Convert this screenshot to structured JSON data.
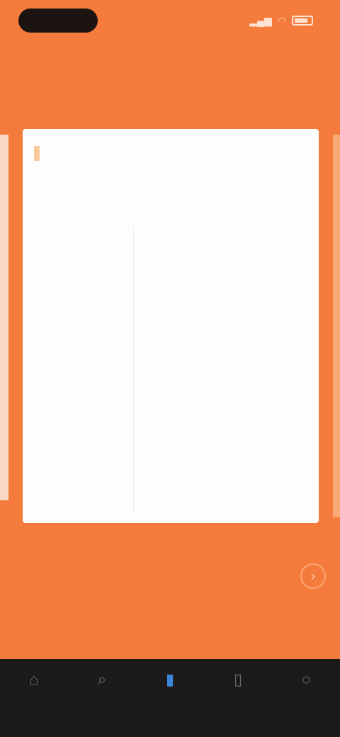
{
  "status": {
    "time": "",
    "icons": [
      "signal-icon",
      "wifi-icon",
      "battery-icon"
    ]
  },
  "header": {
    "title": ""
  },
  "card": {
    "heading_before": "",
    "heading_highlight": "",
    "heading_after": "",
    "rows": [
      {
        "term": "",
        "def": ""
      },
      {
        "term": "",
        "def": ""
      },
      {
        "term": "",
        "def": ""
      },
      {
        "term": "",
        "def": ""
      },
      {
        "term": "",
        "def": ""
      },
      {
        "term": "",
        "def": ""
      },
      {
        "term": "",
        "def": ""
      }
    ]
  },
  "page_indicator": "",
  "nav": {
    "items": [
      {
        "name": "home",
        "label": "",
        "icon": "home-icon"
      },
      {
        "name": "search",
        "label": "",
        "icon": "search-icon"
      },
      {
        "name": "learn",
        "label": "",
        "icon": "book-icon",
        "active": true
      },
      {
        "name": "saved",
        "label": "",
        "icon": "bookmark-icon"
      },
      {
        "name": "profile",
        "label": "",
        "icon": "profile-icon"
      }
    ]
  },
  "colors": {
    "background": "#f47b3c",
    "card": "#fdfdfd",
    "highlight": "#f8c99a",
    "nav_bar": "#1d1a1b",
    "nav_active": "#3a86d8"
  }
}
